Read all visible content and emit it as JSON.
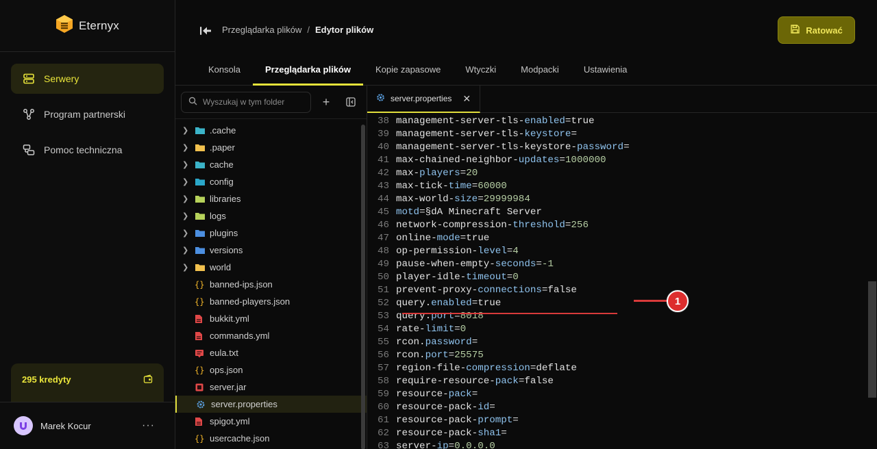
{
  "app": {
    "brand": "Eternyx"
  },
  "sidebar": {
    "items": [
      {
        "label": "Serwery",
        "icon": "server-icon",
        "active": true
      },
      {
        "label": "Program partnerski",
        "icon": "share-icon",
        "active": false
      },
      {
        "label": "Pomoc techniczna",
        "icon": "support-icon",
        "active": false
      }
    ],
    "credits": {
      "label": "295 kredyty",
      "icon": "wallet-icon"
    },
    "user": {
      "name": "Marek Kocur",
      "menu": "···"
    }
  },
  "header": {
    "breadcrumb": {
      "parent": "Przeglądarka plików",
      "separator": "/",
      "current": "Edytor plików"
    },
    "save_label": "Ratować",
    "tabs": [
      "Konsola",
      "Przeglądarka plików",
      "Kopie zapasowe",
      "Wtyczki",
      "Modpacki",
      "Ustawienia"
    ],
    "active_tab": 1
  },
  "file_tree": {
    "search_placeholder": "Wyszukaj w tym folder",
    "add_label": "+",
    "items": [
      {
        "name": ".cache",
        "type": "folder",
        "icon": "folder-cache-icon",
        "color": "#3bb3c8"
      },
      {
        "name": ".paper",
        "type": "folder",
        "icon": "folder-icon",
        "color": "#f2c14e"
      },
      {
        "name": "cache",
        "type": "folder",
        "icon": "folder-cache-icon",
        "color": "#3bb3c8"
      },
      {
        "name": "config",
        "type": "folder",
        "icon": "folder-config-icon",
        "color": "#2aa7c9"
      },
      {
        "name": "libraries",
        "type": "folder",
        "icon": "folder-lib-icon",
        "color": "#b6d25a"
      },
      {
        "name": "logs",
        "type": "folder",
        "icon": "folder-logs-icon",
        "color": "#b6d25a"
      },
      {
        "name": "plugins",
        "type": "folder",
        "icon": "folder-plugins-icon",
        "color": "#4c8fe0"
      },
      {
        "name": "versions",
        "type": "folder",
        "icon": "folder-versions-icon",
        "color": "#4c8fe0"
      },
      {
        "name": "world",
        "type": "folder",
        "icon": "folder-icon",
        "color": "#f2c14e"
      },
      {
        "name": "banned-ips.json",
        "type": "json",
        "icon": "json-icon",
        "color": "#f0b429"
      },
      {
        "name": "banned-players.json",
        "type": "json",
        "icon": "json-icon",
        "color": "#f0b429"
      },
      {
        "name": "bukkit.yml",
        "type": "yml",
        "icon": "yml-icon",
        "color": "#e04848"
      },
      {
        "name": "commands.yml",
        "type": "yml",
        "icon": "yml-icon",
        "color": "#e04848"
      },
      {
        "name": "eula.txt",
        "type": "txt",
        "icon": "txt-icon",
        "color": "#e04848"
      },
      {
        "name": "ops.json",
        "type": "json",
        "icon": "json-icon",
        "color": "#f0b429"
      },
      {
        "name": "server.jar",
        "type": "jar",
        "icon": "jar-icon",
        "color": "#e04848"
      },
      {
        "name": "server.properties",
        "type": "properties",
        "icon": "gear-icon",
        "color": "#5a9fe0",
        "selected": true
      },
      {
        "name": "spigot.yml",
        "type": "yml",
        "icon": "yml-icon",
        "color": "#e04848"
      },
      {
        "name": "usercache.json",
        "type": "json",
        "icon": "json-icon",
        "color": "#f0b429"
      }
    ]
  },
  "editor": {
    "tab_label": "server.properties",
    "close_label": "✕",
    "lines": [
      {
        "n": 38,
        "text": "management-server-tls-enabled=true"
      },
      {
        "n": 39,
        "text": "management-server-tls-keystore="
      },
      {
        "n": 40,
        "text": "management-server-tls-keystore-password="
      },
      {
        "n": 41,
        "text": "max-chained-neighbor-updates=1000000"
      },
      {
        "n": 42,
        "text": "max-players=20"
      },
      {
        "n": 43,
        "text": "max-tick-time=60000"
      },
      {
        "n": 44,
        "text": "max-world-size=29999984"
      },
      {
        "n": 45,
        "text": "motd=§dA Minecraft Server"
      },
      {
        "n": 46,
        "text": "network-compression-threshold=256"
      },
      {
        "n": 47,
        "text": "online-mode=true"
      },
      {
        "n": 48,
        "text": "op-permission-level=4"
      },
      {
        "n": 49,
        "text": "pause-when-empty-seconds=-1"
      },
      {
        "n": 50,
        "text": "player-idle-timeout=0"
      },
      {
        "n": 51,
        "text": "prevent-proxy-connections=false"
      },
      {
        "n": 52,
        "text": "query.enabled=true"
      },
      {
        "n": 53,
        "text": "query.port=8018"
      },
      {
        "n": 54,
        "text": "rate-limit=0"
      },
      {
        "n": 55,
        "text": "rcon.password="
      },
      {
        "n": 56,
        "text": "rcon.port=25575"
      },
      {
        "n": 57,
        "text": "region-file-compression=deflate"
      },
      {
        "n": 58,
        "text": "require-resource-pack=false"
      },
      {
        "n": 59,
        "text": "resource-pack="
      },
      {
        "n": 60,
        "text": "resource-pack-id="
      },
      {
        "n": 61,
        "text": "resource-pack-prompt="
      },
      {
        "n": 62,
        "text": "resource-pack-sha1="
      },
      {
        "n": 63,
        "text": "server-ip=0.0.0.0"
      }
    ]
  },
  "annotation": {
    "label": "1",
    "color": "#dd2e2e"
  }
}
